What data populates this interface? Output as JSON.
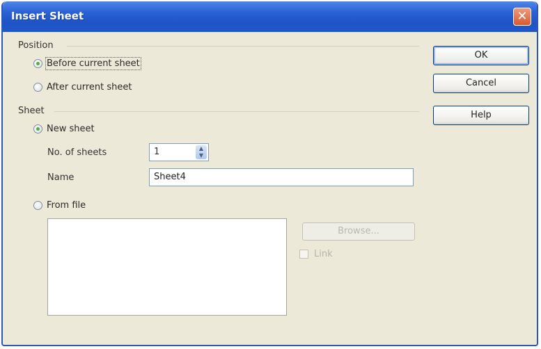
{
  "window": {
    "title": "Insert Sheet",
    "close_glyph": "✕"
  },
  "position": {
    "label": "Position",
    "before": "Before current sheet",
    "after": "After current sheet",
    "selected": "before"
  },
  "sheet": {
    "label": "Sheet",
    "new_sheet": "New sheet",
    "num_sheets_label": "No. of sheets",
    "num_sheets_value": "1",
    "name_label": "Name",
    "name_value": "Sheet4",
    "from_file": "From file",
    "browse_label": "Browse...",
    "link_label": "Link",
    "selected": "new"
  },
  "buttons": {
    "ok": "OK",
    "cancel": "Cancel",
    "help": "Help"
  },
  "colors": {
    "titlebar": "#2a62d6",
    "window_bg": "#ece9d8"
  }
}
